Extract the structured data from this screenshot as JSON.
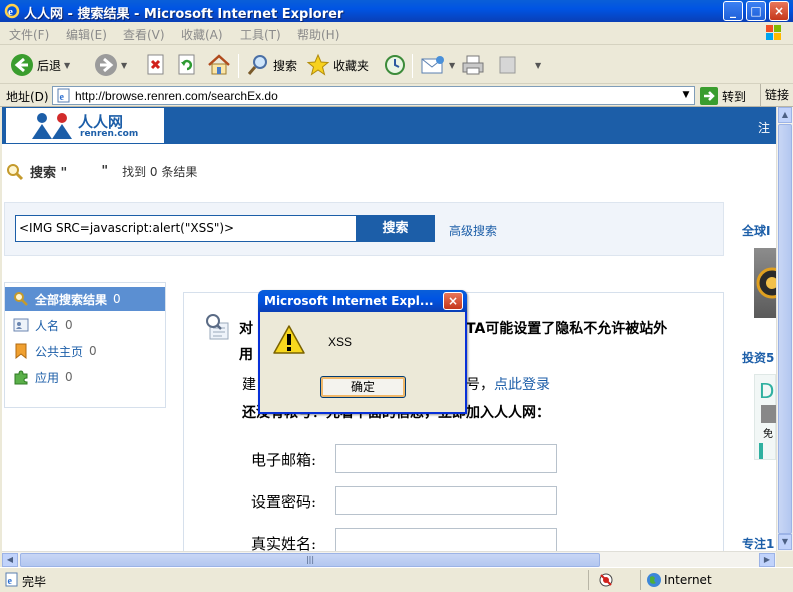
{
  "window": {
    "title": "人人网 - 搜索结果 - Microsoft Internet Explorer",
    "minimize": "_",
    "maximize": "□",
    "close": "×"
  },
  "menu": [
    "文件(F)",
    "编辑(E)",
    "查看(V)",
    "收藏(A)",
    "工具(T)",
    "帮助(H)"
  ],
  "toolbar": {
    "back_label": "后退",
    "search_label": "搜索",
    "favorites_label": "收藏夹"
  },
  "address": {
    "label": "地址(D)",
    "url": "http://browse.renren.com/searchEx.do",
    "go_label": "转到",
    "links_label": "链接"
  },
  "site": {
    "logo_text": "人人网",
    "logo_sub": "renren.com",
    "header_right": "注"
  },
  "search": {
    "title_prefix": "搜索 \"",
    "title_suffix": "\"",
    "result_count": "找到 0 条结果",
    "input_value": "<IMG SRC=javascript:alert(\"XSS\")>",
    "button_label": "搜索",
    "advanced_link": "高级搜索"
  },
  "sidenav": [
    {
      "label": "全部搜索结果",
      "count": "0",
      "active": true
    },
    {
      "label": "人名",
      "count": "0",
      "active": false
    },
    {
      "label": "公共主页",
      "count": "0",
      "active": false
    },
    {
      "label": "应用",
      "count": "0",
      "active": false
    }
  ],
  "result_box": {
    "line1_start": "对",
    "line1_end": "TA可能设置了隐私不允许被站外",
    "line2": "用",
    "line3_start": "建",
    "line3_mid": "号，",
    "login_link": "点此登录",
    "line4": "还没有帐号？先看下面的信息，立即加入人人网：",
    "email_label": "电子邮箱:",
    "password_label": "设置密码:",
    "realname_label": "真实姓名:"
  },
  "right_col": {
    "title1": "全球I",
    "title2": "投资5",
    "title3": "专注1",
    "ad_letter": "D",
    "ad_text": "免"
  },
  "status": {
    "done": "完毕",
    "zone": "Internet"
  },
  "dialog": {
    "title": "Microsoft Internet Expl...",
    "message": "XSS",
    "ok_label": "确定",
    "close": "×"
  },
  "colors": {
    "xp_blue": "#0054e3",
    "site_blue": "#1c5ea8",
    "nav_active": "#5b8fd2"
  }
}
